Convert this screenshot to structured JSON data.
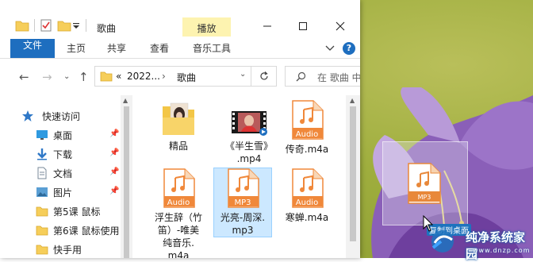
{
  "window": {
    "title": "歌曲",
    "context_tab_group": "播放",
    "ribbon_tabs": [
      "文件",
      "主页",
      "共享",
      "查看",
      "音乐工具"
    ],
    "help": "?"
  },
  "address": {
    "breadcrumb_prefix": "«",
    "segment1": "2022...",
    "separator": "›",
    "segment2": "歌曲",
    "search_placeholder": "在 歌曲 中"
  },
  "nav_pane": {
    "items": [
      {
        "label": "快速访问",
        "icon": "star-icon",
        "pinned": false
      },
      {
        "label": "桌面",
        "icon": "desktop-icon",
        "pinned": true
      },
      {
        "label": "下载",
        "icon": "download-icon",
        "pinned": true
      },
      {
        "label": "文档",
        "icon": "document-icon",
        "pinned": true
      },
      {
        "label": "图片",
        "icon": "picture-icon",
        "pinned": true
      },
      {
        "label": "第5课 鼠标",
        "icon": "folder-icon",
        "pinned": false
      },
      {
        "label": "第6课 鼠标使用",
        "icon": "folder-icon",
        "pinned": false
      },
      {
        "label": "快手用",
        "icon": "folder-icon",
        "pinned": false
      }
    ]
  },
  "files": [
    {
      "name": "精品",
      "type": "folder"
    },
    {
      "name": "《半生雪》\n.mp4",
      "type": "video"
    },
    {
      "name": "传奇.m4a",
      "type": "audio",
      "badge": "Audio"
    },
    {
      "name": "浮生辞（竹\n笛）-唯美\n纯音乐.\nm4a",
      "type": "audio",
      "badge": "Audio"
    },
    {
      "name": "光亮-周深.\nmp3",
      "type": "mp3",
      "badge": "MP3",
      "selected": true
    },
    {
      "name": "寒蝉.m4a",
      "type": "audio",
      "badge": "Audio"
    }
  ],
  "drag": {
    "badge": "MP3",
    "tooltip": "复制到桌面"
  },
  "watermark": {
    "text": "纯净系统家园",
    "url": "www.dnzp.com"
  },
  "colors": {
    "accent": "#1e6ebf",
    "context_tab": "#fdf3b0",
    "audio_orange": "#f0883a",
    "selection": "#cce8ff"
  }
}
